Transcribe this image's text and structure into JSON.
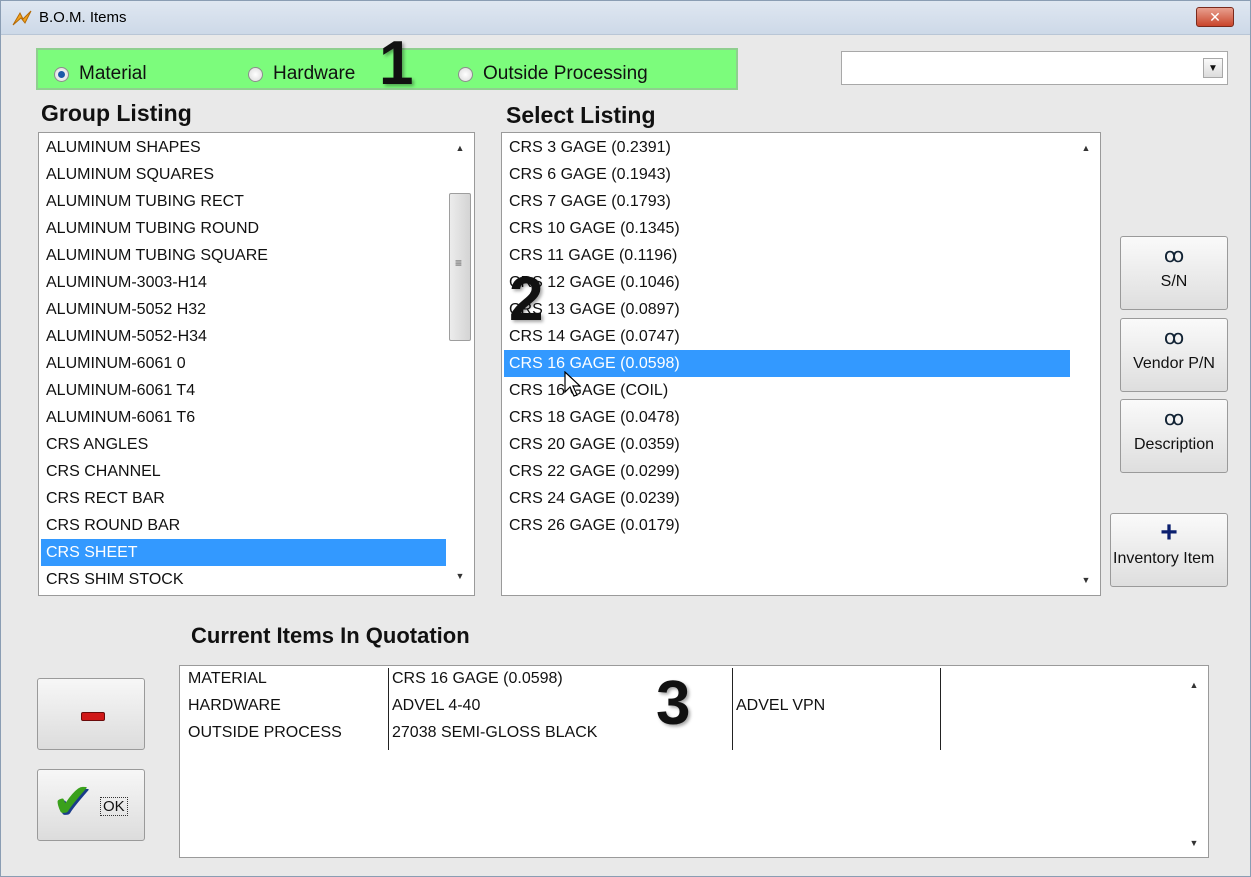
{
  "window": {
    "title": "B.O.M. Items",
    "close_glyph": "✕"
  },
  "radios": [
    {
      "label": "Material",
      "checked": true
    },
    {
      "label": "Hardware",
      "checked": false
    },
    {
      "label": "Outside Processing",
      "checked": false
    }
  ],
  "annotations": {
    "one": "1",
    "two": "2",
    "three": "3"
  },
  "combo": {
    "value": "",
    "arrow_glyph": "▼"
  },
  "group_listing": {
    "label": "Group Listing",
    "items": [
      "ALUMINUM SHAPES",
      "ALUMINUM SQUARES",
      "ALUMINUM TUBING RECT",
      "ALUMINUM TUBING ROUND",
      "ALUMINUM TUBING SQUARE",
      "ALUMINUM-3003-H14",
      "ALUMINUM-5052 H32",
      "ALUMINUM-5052-H34",
      "ALUMINUM-6061 0",
      "ALUMINUM-6061 T4",
      "ALUMINUM-6061 T6",
      "CRS ANGLES",
      "CRS CHANNEL",
      "CRS RECT BAR",
      "CRS ROUND BAR",
      "CRS SHEET",
      "CRS SHIM STOCK"
    ],
    "selected": "CRS SHEET"
  },
  "select_listing": {
    "label": "Select Listing",
    "items": [
      "CRS  3 GAGE (0.2391)",
      "CRS  6 GAGE (0.1943)",
      "CRS  7 GAGE (0.1793)",
      "CRS 10 GAGE (0.1345)",
      "CRS 11 GAGE (0.1196)",
      "CRS 12 GAGE (0.1046)",
      "CRS 13 GAGE (0.0897)",
      "CRS 14 GAGE (0.0747)",
      "CRS 16 GAGE (0.0598)",
      "CRS 16 GAGE (COIL)",
      "CRS 18 GAGE (0.0478)",
      "CRS 20 GAGE (0.0359)",
      "CRS 22 GAGE (0.0299)",
      "CRS 24 GAGE (0.0239)",
      "CRS 26 GAGE (0.0179)"
    ],
    "selected": "CRS 16 GAGE (0.0598)"
  },
  "side_buttons": {
    "sn": {
      "label": "S/N",
      "icon": "binoculars-icon",
      "glyph": "ꝏ"
    },
    "vendor_pn": {
      "label": "Vendor P/N",
      "icon": "binoculars-icon",
      "glyph": "ꝏ"
    },
    "description": {
      "label": "Description",
      "icon": "binoculars-icon",
      "glyph": "ꝏ"
    },
    "inventory_item": {
      "label": "Inventory Item",
      "icon": "plus-icon",
      "glyph": "+"
    }
  },
  "quotation": {
    "label": "Current Items In Quotation",
    "rows": [
      {
        "type": "MATERIAL",
        "item": "CRS 16 GAGE (0.0598)",
        "extra": ""
      },
      {
        "type": "HARDWARE",
        "item": "ADVEL  4-40",
        "extra": "ADVEL VPN"
      },
      {
        "type": "OUTSIDE PROCESS",
        "item": "27038 SEMI-GLOSS BLACK",
        "extra": ""
      }
    ]
  },
  "bottom_buttons": {
    "remove": {
      "icon": "minus-icon"
    },
    "ok": {
      "label": "OK",
      "icon": "checkmark-icon",
      "glyph": "✔"
    }
  },
  "scroll": {
    "up": "▲",
    "down": "▼",
    "grip": "≡"
  }
}
